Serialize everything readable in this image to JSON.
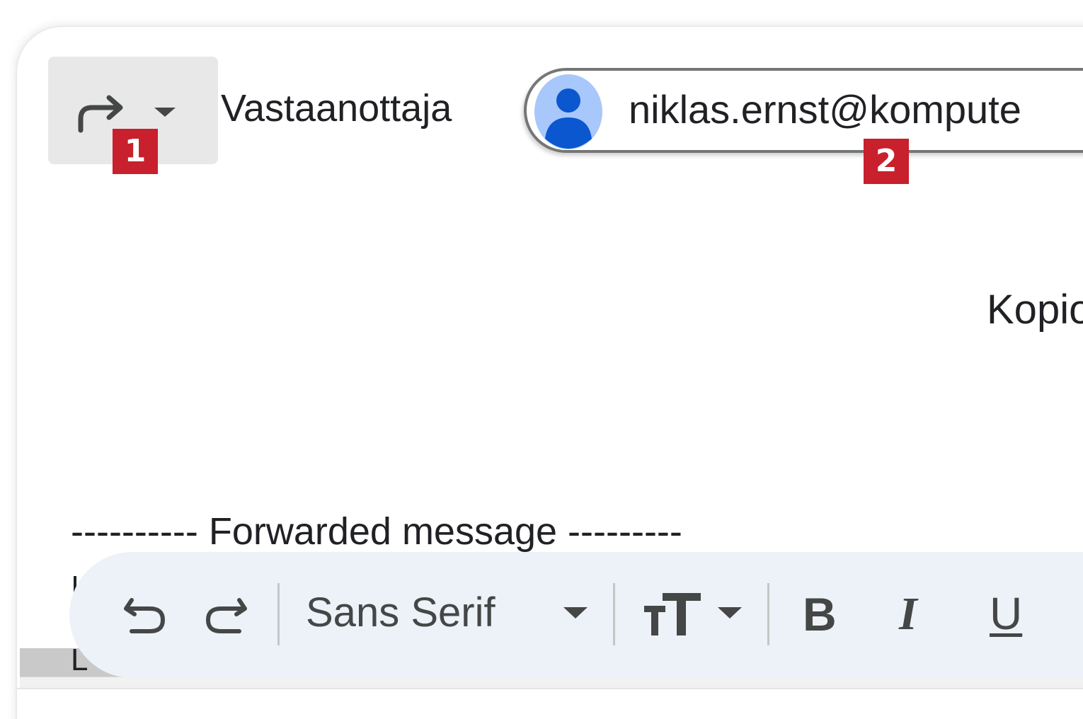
{
  "header": {
    "to_label": "Vastaanottaja",
    "cc_label": "Kopio",
    "recipient": {
      "email": "niklas.ernst@kompute"
    }
  },
  "icons": {
    "reply_type": "forward-icon",
    "reply_type_menu": "chevron-down-icon",
    "recipient_avatar": "person-icon",
    "undo": "undo-icon",
    "redo": "redo-icon",
    "text_size": "text-size-icon"
  },
  "badges": {
    "first": "1",
    "second": "2"
  },
  "body": {
    "forwarded_header": "---------- Forwarded message ---------",
    "line_two_fragment": "L"
  },
  "toolbar": {
    "font_name": "Sans Serif",
    "bold_label": "B",
    "italic_label": "I",
    "underline_label": "U"
  },
  "colors": {
    "badge": "#c8202c",
    "avatar_bg": "#a8c7fa",
    "avatar_fg": "#0b57d0",
    "toolbar_bg": "#edf1f8",
    "icon_gray": "#444746"
  }
}
